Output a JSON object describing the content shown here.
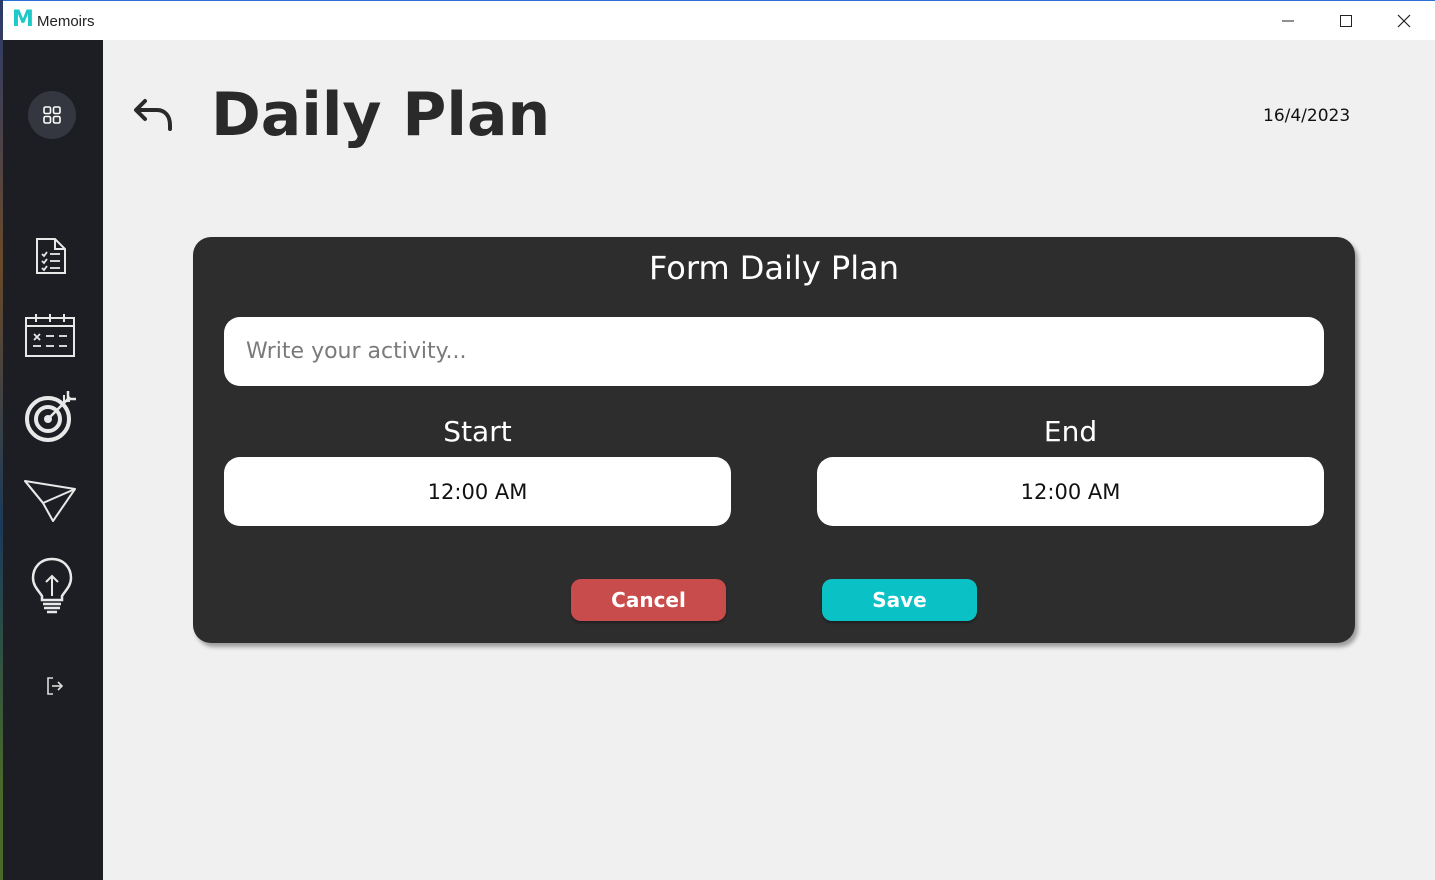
{
  "window": {
    "app_logo": "M",
    "title": "Memoirs",
    "controls": [
      "minimize-icon",
      "maximize-icon",
      "close-icon"
    ]
  },
  "sidebar": {
    "items": [
      {
        "icon": "dashboard-grid-icon"
      },
      {
        "icon": "checklist-icon"
      },
      {
        "icon": "calendar-icon"
      },
      {
        "icon": "target-icon"
      },
      {
        "icon": "paper-plane-icon"
      },
      {
        "icon": "lightbulb-icon"
      },
      {
        "icon": "logout-icon"
      }
    ]
  },
  "header": {
    "back_icon": "undo-arrow-icon",
    "title": "Daily Plan",
    "date": "16/4/2023"
  },
  "form": {
    "title": "Form Daily Plan",
    "activity_placeholder": "Write your activity...",
    "activity_value": "",
    "start_label": "Start",
    "start_value": "12:00 AM",
    "end_label": "End",
    "end_value": "12:00 AM",
    "cancel_label": "Cancel",
    "save_label": "Save"
  },
  "colors": {
    "sidebar_bg": "#1c1e24",
    "main_bg": "#f0f0f0",
    "card_bg": "#2d2d2e",
    "cancel": "#c94c4c",
    "save": "#0ac2c6",
    "logo": "#1ec8c8"
  }
}
